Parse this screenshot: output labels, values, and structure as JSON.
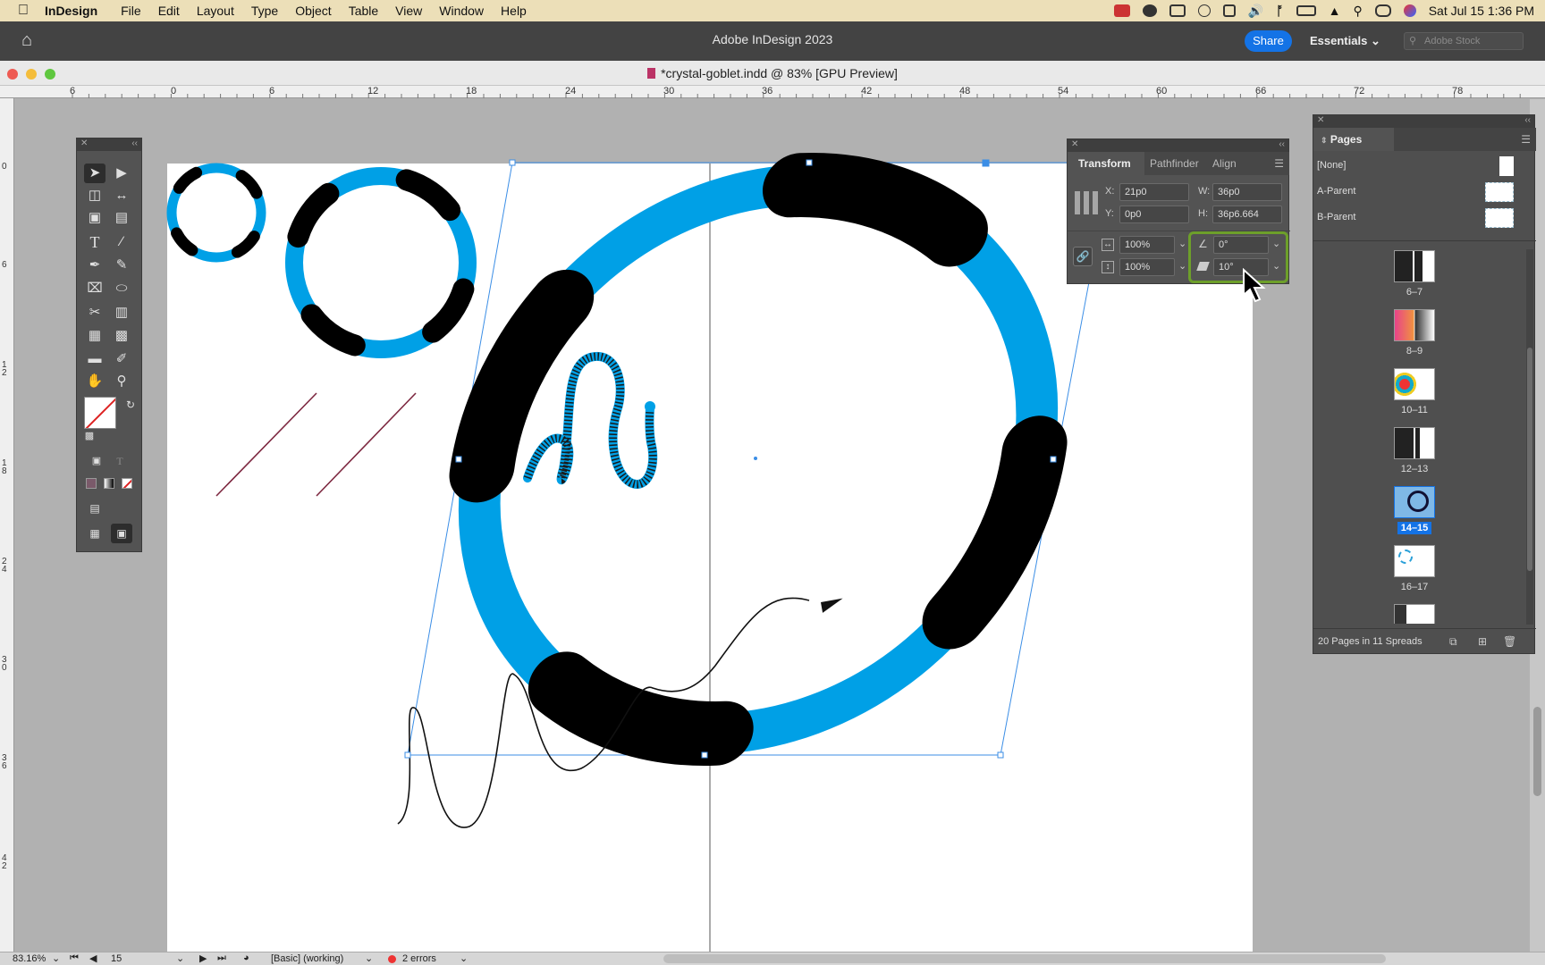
{
  "menubar": {
    "app_name": "InDesign",
    "items": [
      "File",
      "Edit",
      "Layout",
      "Type",
      "Object",
      "Table",
      "View",
      "Window",
      "Help"
    ],
    "datetime": "Sat Jul 15  1:36 PM"
  },
  "app": {
    "title": "Adobe InDesign 2023",
    "share_label": "Share",
    "workspace_label": "Essentials",
    "stock_placeholder": "Adobe Stock"
  },
  "document": {
    "tab_title": "*crystal-goblet.indd @ 83% [GPU Preview]"
  },
  "rulers": {
    "horizontal": [
      "6",
      "0",
      "6",
      "12",
      "18",
      "24",
      "30",
      "36",
      "42",
      "48",
      "54",
      "60",
      "66",
      "72",
      "78"
    ],
    "vertical": [
      "0",
      "6",
      "1\n2",
      "1\n8",
      "2\n4",
      "3\n0",
      "3\n6",
      "4\n2"
    ]
  },
  "transform_panel": {
    "tabs": [
      "Transform",
      "Pathfinder",
      "Align"
    ],
    "x_label": "X:",
    "x_value": "21p0",
    "y_label": "Y:",
    "y_value": "0p0",
    "w_label": "W:",
    "w_value": "36p0",
    "h_label": "H:",
    "h_value": "36p6.664",
    "scale_x": "100%",
    "scale_y": "100%",
    "rotate": "0°",
    "shear": "10°"
  },
  "pages_panel": {
    "title": "Pages",
    "parents": [
      {
        "label": "[None]"
      },
      {
        "label": "A-Parent"
      },
      {
        "label": "B-Parent"
      }
    ],
    "spreads": [
      {
        "label": "6–7",
        "selected": false
      },
      {
        "label": "8–9",
        "selected": false
      },
      {
        "label": "10–11",
        "selected": false
      },
      {
        "label": "12–13",
        "selected": false
      },
      {
        "label": "14–15",
        "selected": true
      },
      {
        "label": "16–17",
        "selected": false
      }
    ],
    "footer": "20 Pages in 11 Spreads"
  },
  "statusbar": {
    "zoom": "83.16%",
    "page": "15",
    "profile": "[Basic] (working)",
    "errors": "2 errors"
  },
  "colors": {
    "accent_blue": "#00a0e6",
    "selection_blue": "#1473e6",
    "highlight_green": "#6d9f2a",
    "line_maroon": "#7d2840"
  }
}
